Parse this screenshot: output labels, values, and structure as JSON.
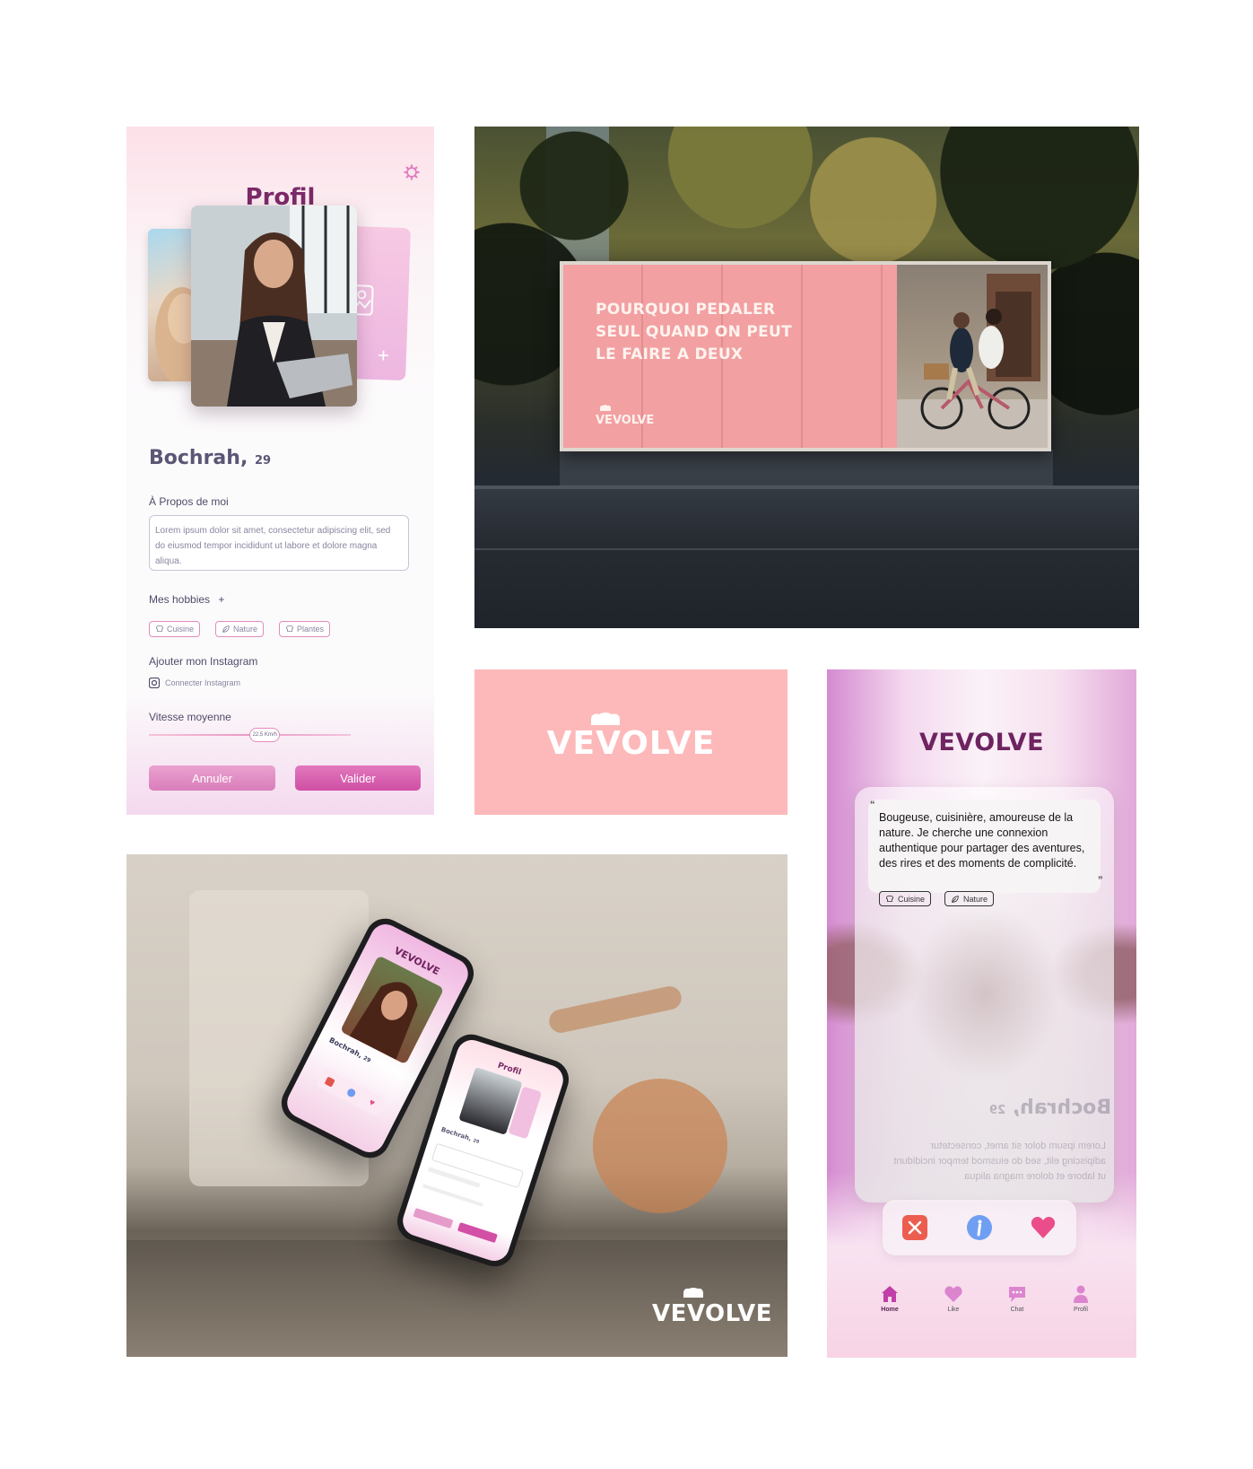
{
  "colors": {
    "brand_purple": "#7a2a68",
    "pink": "#fdb9ba",
    "accent_pink": "#d64fa6"
  },
  "profile": {
    "title": "Profil",
    "name": "Bochrah,",
    "age": "29",
    "about_label": "À Propos de moi",
    "about_text": "Lorem ipsum dolor sit amet, consectetur adipiscing elit, sed do eiusmod tempor incididunt ut labore et dolore magna aliqua.",
    "hobbies_label": "Mes hobbies",
    "add_symbol": "+",
    "hobbies": [
      {
        "label": "Cuisine",
        "icon": "chef-hat-icon"
      },
      {
        "label": "Nature",
        "icon": "leaf-icon"
      },
      {
        "label": "Plantes",
        "icon": "chef-hat-icon"
      }
    ],
    "instagram_label": "Ajouter mon Instagram",
    "instagram_connect": "Connecter  Instagram",
    "speed_label": "Vitesse moyenne",
    "speed_value": "22,5 Km/h",
    "speed_fraction": 0.57,
    "cancel": "Annuler",
    "validate": "Valider"
  },
  "billboard": {
    "line1": "POURQUOI PEDALER",
    "line2": "SEUL QUAND ON PEUT",
    "line3": "LE FAIRE A DEUX",
    "logo": "VEVOLVE"
  },
  "logo_tile": {
    "logo": "VEVOLVE"
  },
  "mockup": {
    "logo": "VEVOLVE",
    "phone_a": {
      "brand": "VEVOLVE",
      "name": "Bochrah,",
      "age": "29"
    },
    "phone_b": {
      "title": "Profil",
      "name": "Bochrah,",
      "age": "29"
    }
  },
  "home": {
    "logo": "VEVOLVE",
    "quote_open": "“",
    "quote_close": "”",
    "bio": "Bougeuse, cuisinière, amoureuse de la nature. Je cherche une connexion authentique pour partager des aventures, des rires et des moments de complicité.",
    "tags": [
      {
        "label": "Cuisine",
        "icon": "chef-hat-icon"
      },
      {
        "label": "Nature",
        "icon": "leaf-icon"
      }
    ],
    "name_mirrored": "Bochrah,",
    "age_mirrored": "29",
    "mirror_text": "Lorem ipsum dolor sit amet, consectetur adipiscing elit, sed do eiusmod tempor incididunt ut labore et dolore magna aliqua",
    "nav": [
      {
        "label": "Home",
        "icon": "home-icon",
        "active": true
      },
      {
        "label": "Like",
        "icon": "heart-icon",
        "active": false
      },
      {
        "label": "Chat",
        "icon": "chat-icon",
        "active": false
      },
      {
        "label": "Profil",
        "icon": "profile-icon",
        "active": false
      }
    ]
  }
}
